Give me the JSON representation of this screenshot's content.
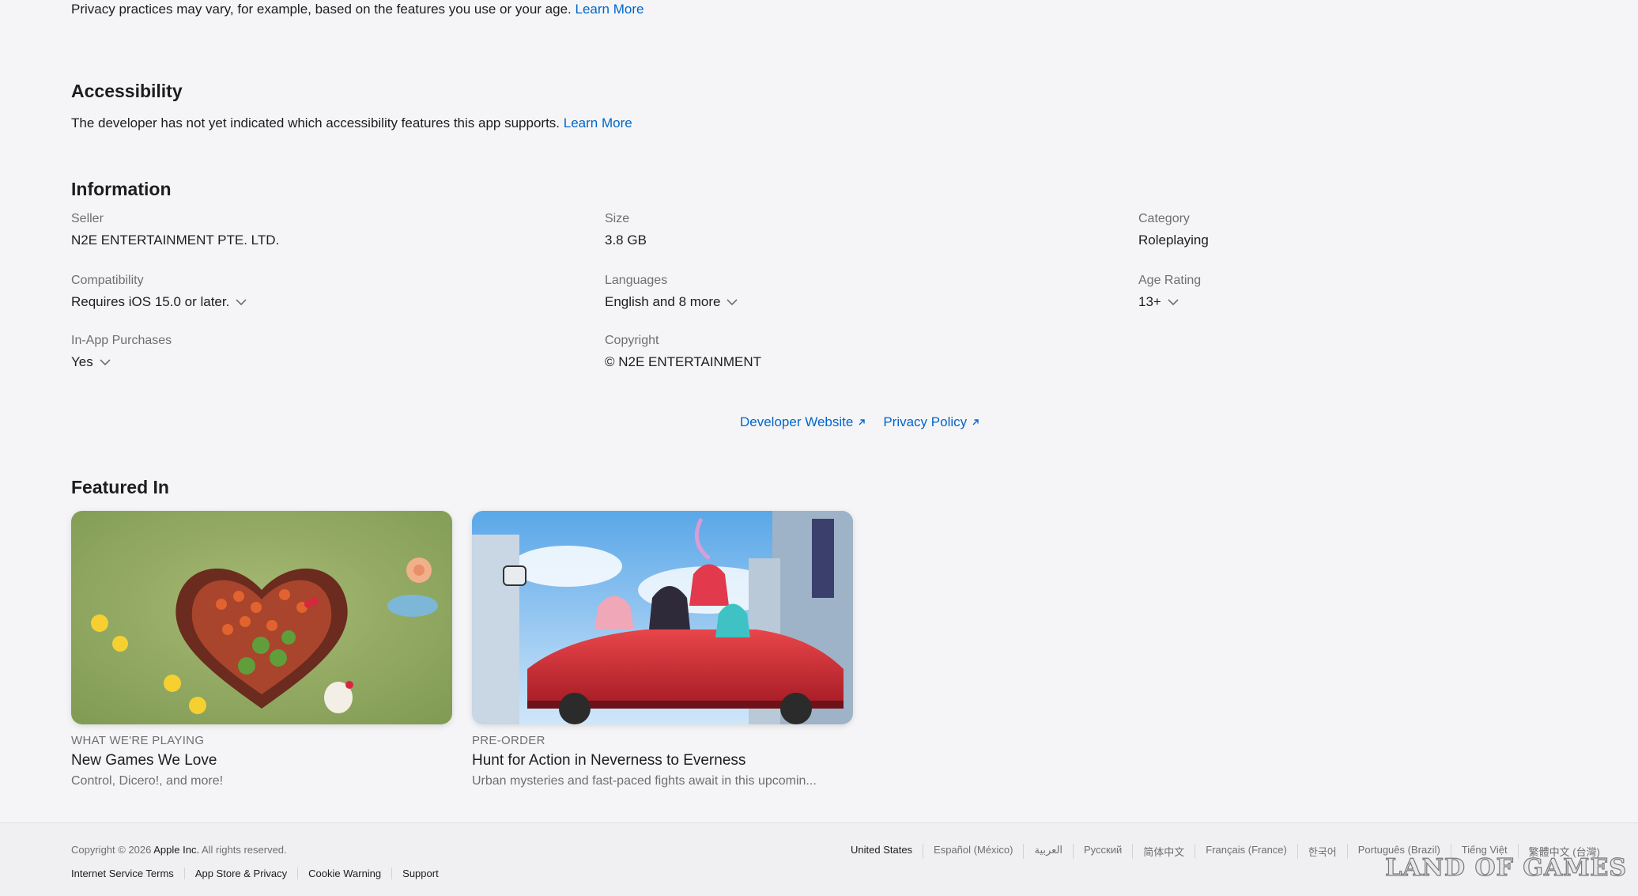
{
  "privacy": {
    "text": "Privacy practices may vary, for example, based on the features you use or your age.",
    "link": "Learn More"
  },
  "accessibility": {
    "title": "Accessibility",
    "text": "The developer has not yet indicated which accessibility features this app supports.",
    "link": "Learn More"
  },
  "information": {
    "title": "Information",
    "seller": {
      "label": "Seller",
      "value": "N2E ENTERTAINMENT PTE. LTD."
    },
    "size": {
      "label": "Size",
      "value": "3.8 GB"
    },
    "category": {
      "label": "Category",
      "value": "Roleplaying"
    },
    "compatibility": {
      "label": "Compatibility",
      "value": "Requires iOS 15.0 or later."
    },
    "languages": {
      "label": "Languages",
      "value": "English and 8 more"
    },
    "age_rating": {
      "label": "Age Rating",
      "value": "13+"
    },
    "in_app_purchases": {
      "label": "In-App Purchases",
      "value": "Yes"
    },
    "copyright": {
      "label": "Copyright",
      "value": "© N2E ENTERTAINMENT"
    },
    "developer_website": "Developer Website",
    "privacy_policy": "Privacy Policy"
  },
  "featured": {
    "title": "Featured In",
    "cards": [
      {
        "eyebrow": "WHAT WE'RE PLAYING",
        "title": "New Games We Love",
        "subtitle": "Control, Dicero!, and more!"
      },
      {
        "eyebrow": "PRE-ORDER",
        "title": "Hunt for Action in Neverness to Everness",
        "subtitle": "Urban mysteries and fast-paced fights await in this upcomin..."
      }
    ]
  },
  "footer": {
    "copyright_prefix": "Copyright © 2026",
    "company": "Apple Inc.",
    "rights": "All rights reserved.",
    "legal_links": [
      "Internet Service Terms",
      "App Store & Privacy",
      "Cookie Warning",
      "Support"
    ],
    "locales": [
      "United States",
      "Español (México)",
      "العربية",
      "Русский",
      "简体中文",
      "Français (France)",
      "한국어",
      "Português (Brazil)",
      "Tiếng Việt",
      "繁體中文 (台灣)"
    ]
  },
  "watermark": "LAND OF GAMES"
}
